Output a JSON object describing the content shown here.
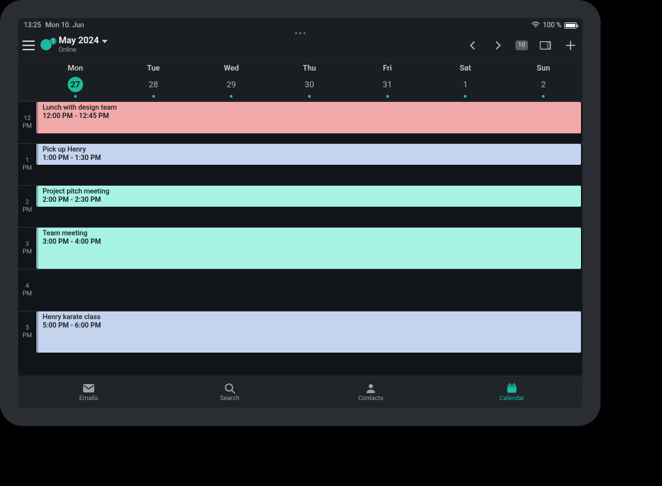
{
  "status": {
    "time": "13:25",
    "date": "Mon 10. Jun",
    "battery_text": "100 %"
  },
  "header": {
    "title": "May 2024",
    "subtitle": "Online",
    "badge": "1",
    "date_pill": "10"
  },
  "week": {
    "days": [
      {
        "name": "Mon",
        "num": "27",
        "selected": true
      },
      {
        "name": "Tue",
        "num": "28",
        "selected": false
      },
      {
        "name": "Wed",
        "num": "29",
        "selected": false
      },
      {
        "name": "Thu",
        "num": "30",
        "selected": false
      },
      {
        "name": "Fri",
        "num": "31",
        "selected": false
      },
      {
        "name": "Sat",
        "num": "1",
        "selected": false
      },
      {
        "name": "Sun",
        "num": "2",
        "selected": false
      }
    ]
  },
  "hours": [
    {
      "h": "12",
      "ampm": "PM"
    },
    {
      "h": "1",
      "ampm": "PM"
    },
    {
      "h": "2",
      "ampm": "PM"
    },
    {
      "h": "3",
      "ampm": "PM"
    },
    {
      "h": "4",
      "ampm": "PM"
    },
    {
      "h": "5",
      "ampm": "PM"
    }
  ],
  "events": [
    {
      "title": "Lunch with design team",
      "time": "12:00 PM - 12:45 PM",
      "hour_index": 0,
      "top": 0,
      "height": 45,
      "color": "pink"
    },
    {
      "title": "Pick up Henry",
      "time": "1:00 PM - 1:30 PM",
      "hour_index": 1,
      "top": 0,
      "height": 30,
      "color": "blue"
    },
    {
      "title": "Project pitch meeting",
      "time": "2:00 PM - 2:30 PM",
      "hour_index": 2,
      "top": 0,
      "height": 30,
      "color": "teal"
    },
    {
      "title": "Team meeting",
      "time": "3:00 PM - 4:00 PM",
      "hour_index": 3,
      "top": 0,
      "height": 59,
      "color": "teal"
    },
    {
      "title": "Henry karate class",
      "time": "5:00 PM - 6:00 PM",
      "hour_index": 5,
      "top": 0,
      "height": 59,
      "color": "blue"
    }
  ],
  "nav": {
    "items": [
      {
        "label": "Emails",
        "icon": "mail"
      },
      {
        "label": "Search",
        "icon": "search"
      },
      {
        "label": "Contacts",
        "icon": "person"
      },
      {
        "label": "Calendar",
        "icon": "calendar",
        "active": true
      }
    ]
  }
}
